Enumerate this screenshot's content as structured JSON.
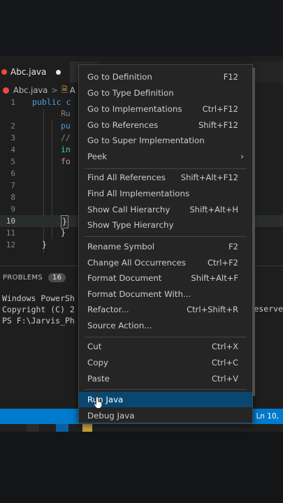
{
  "editor": {
    "tab_name": "Abc.java",
    "breadcrumb": {
      "file": "Abc.java",
      "separator": ">",
      "symbol": "A"
    },
    "lines": [
      {
        "num": "1",
        "text": "public c"
      },
      {
        "num": "",
        "text": "Ru"
      },
      {
        "num": "2",
        "text": "pu"
      },
      {
        "num": "3",
        "text": "//"
      },
      {
        "num": "4",
        "text": "in"
      },
      {
        "num": "5",
        "text": "fo"
      },
      {
        "num": "6",
        "text": ""
      },
      {
        "num": "7",
        "text": ""
      },
      {
        "num": "8",
        "text": ""
      },
      {
        "num": "9",
        "text": ""
      },
      {
        "num": "10",
        "text": "}"
      },
      {
        "num": "11",
        "text": "}"
      },
      {
        "num": "12",
        "text": "}"
      }
    ]
  },
  "panel": {
    "problems_label": "PROBLEMS",
    "problems_count": "16",
    "terminal_lines": [
      "Windows PowerSh",
      "Copyright (C) 2",
      "",
      "PS F:\\Jarvis_Ph"
    ],
    "terminal_right": "reserve"
  },
  "statusbar": {
    "position": "Ln 10,"
  },
  "context_menu": {
    "items": [
      {
        "label": "Go to Definition",
        "shortcut": "F12"
      },
      {
        "label": "Go to Type Definition",
        "shortcut": ""
      },
      {
        "label": "Go to Implementations",
        "shortcut": "Ctrl+F12"
      },
      {
        "label": "Go to References",
        "shortcut": "Shift+F12"
      },
      {
        "label": "Go to Super Implementation",
        "shortcut": ""
      },
      {
        "label": "Peek",
        "shortcut": ""
      },
      {
        "label": "Find All References",
        "shortcut": "Shift+Alt+F12"
      },
      {
        "label": "Find All Implementations",
        "shortcut": ""
      },
      {
        "label": "Show Call Hierarchy",
        "shortcut": "Shift+Alt+H"
      },
      {
        "label": "Show Type Hierarchy",
        "shortcut": ""
      },
      {
        "label": "Rename Symbol",
        "shortcut": "F2"
      },
      {
        "label": "Change All Occurrences",
        "shortcut": "Ctrl+F2"
      },
      {
        "label": "Format Document",
        "shortcut": "Shift+Alt+F"
      },
      {
        "label": "Format Document With...",
        "shortcut": ""
      },
      {
        "label": "Refactor...",
        "shortcut": "Ctrl+Shift+R"
      },
      {
        "label": "Source Action...",
        "shortcut": ""
      },
      {
        "label": "Cut",
        "shortcut": "Ctrl+X"
      },
      {
        "label": "Copy",
        "shortcut": "Ctrl+C"
      },
      {
        "label": "Paste",
        "shortcut": "Ctrl+V"
      },
      {
        "label": "Run Java",
        "shortcut": ""
      },
      {
        "label": "Debug Java",
        "shortcut": ""
      }
    ]
  },
  "colors": {
    "selected_item": "#094771",
    "statusbar": "#007acc",
    "error": "#e74c3c"
  },
  "icons": [
    "error-dot-icon",
    "unsaved-dot-icon",
    "class-icon",
    "chevron-right-icon",
    "mouse-pointer-icon"
  ]
}
